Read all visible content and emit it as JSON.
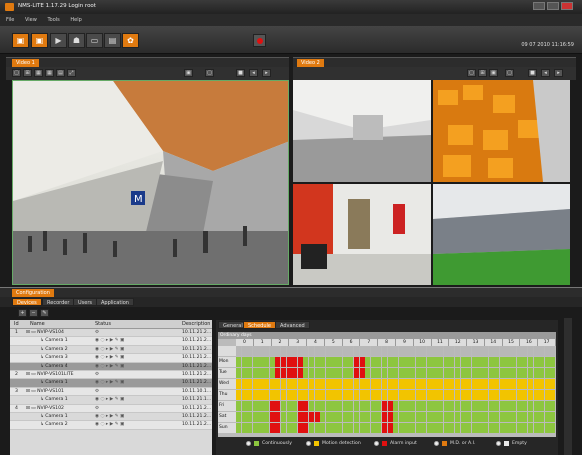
{
  "window": {
    "title": "NMS-LITE 1.17.29 Login root"
  },
  "menu": [
    "File",
    "View",
    "Tools",
    "Help"
  ],
  "toolbar": {
    "clock": "09 07 2010 11:16:59"
  },
  "panes": [
    {
      "tab": "Video 1"
    },
    {
      "tab": "Video 2"
    }
  ],
  "config": {
    "tab": "Configuration",
    "subtabs": [
      "Devices",
      "Recorder",
      "Users",
      "Application"
    ]
  },
  "devices": {
    "columns": [
      "Id",
      "Name",
      "Status",
      "Description"
    ],
    "rows": [
      {
        "id": "1",
        "name": "NVIP-VS104",
        "desc": "10.11.21.2...",
        "level": 0
      },
      {
        "id": "",
        "name": "Camera 1",
        "desc": "10.11.21.2...",
        "level": 1
      },
      {
        "id": "",
        "name": "Camera 2",
        "desc": "10.11.21.2...",
        "level": 1
      },
      {
        "id": "",
        "name": "Camera 3",
        "desc": "10.11.21.2...",
        "level": 1
      },
      {
        "id": "",
        "name": "Camera 4",
        "desc": "10.11.21.2...",
        "level": 1
      },
      {
        "id": "2",
        "name": "NVIP-VS101LITE",
        "desc": "10.11.21.2...",
        "level": 0
      },
      {
        "id": "",
        "name": "Camera 1",
        "desc": "10.11.21.2...",
        "level": 1
      },
      {
        "id": "3",
        "name": "NVIP-VS101",
        "desc": "10.11.10.1...",
        "level": 0
      },
      {
        "id": "",
        "name": "Camera 1",
        "desc": "10.11.21.1...",
        "level": 1
      },
      {
        "id": "4",
        "name": "NVIP-VS102",
        "desc": "10.11.21.2...",
        "level": 0
      },
      {
        "id": "",
        "name": "Camera 1",
        "desc": "10.11.21.2...",
        "level": 1
      },
      {
        "id": "",
        "name": "Camera 2",
        "desc": "10.11.21.2...",
        "level": 1
      }
    ]
  },
  "schedule": {
    "tabs": [
      "General",
      "Schedule",
      "Advanced"
    ],
    "header": "Ordinary days",
    "hours": [
      "0",
      "1",
      "2",
      "3",
      "4",
      "5",
      "6",
      "7",
      "8",
      "9",
      "10",
      "11",
      "12",
      "13",
      "14",
      "15",
      "16",
      "17"
    ],
    "days": [
      "Mon",
      "Tue",
      "Wed",
      "Thu",
      "Fri",
      "Sat",
      "Sun"
    ],
    "colors": {
      "C": "#8dc63f",
      "M": "#f2c400",
      "A": "#e01010",
      "O": "#e07a10",
      "E": "#e8e8e8"
    },
    "rows": [
      "GGGGGGGGGGGGGGGGGGGGGGGGGGGGGGGGGGGGGGGGGGGGGGGGGGGGGGGGG",
      "CCCCCCCAAAAACCCCCCCCCAACCCCCCCCCCCCCCCCCCCCCCCCCCCCCCCCCC",
      "CCCCCCCAAAAACCCCCCCCCAACCCCCCCCCCCCCCCCCCCCCCCCCCCCCCCCCC",
      "MMMMMMMMMMMMMMMMMMMMMMMMMMMMMMMMMMMMMMMMMMMMMMMMMMMMMMMMM",
      "MMMMMMMMMMMMMMMMMMMMMMMMMMMMMMMMMMMMMMMMMMMMMMMMMMMMMMMMM",
      "CCCCCCAACCCAACCCCCCCCCCCCCAACCCCCCCCCCCCCCCCCCCCCCCCCCCCC",
      "CCCCCCAACCCAAAACCCCCCCCCCCAACCCCCCCCCCCCCCCCCCCCCCCCCCCCC",
      "CCCCCCAACCCAACCCCCCCCCCCCCAACCCCCCCCCCCCCCCCCCCCCCCCCCCCC"
    ],
    "legend": [
      "Continuously",
      "Motion detection",
      "Alarm input",
      "M.D. or A.I.",
      "Empty"
    ]
  }
}
